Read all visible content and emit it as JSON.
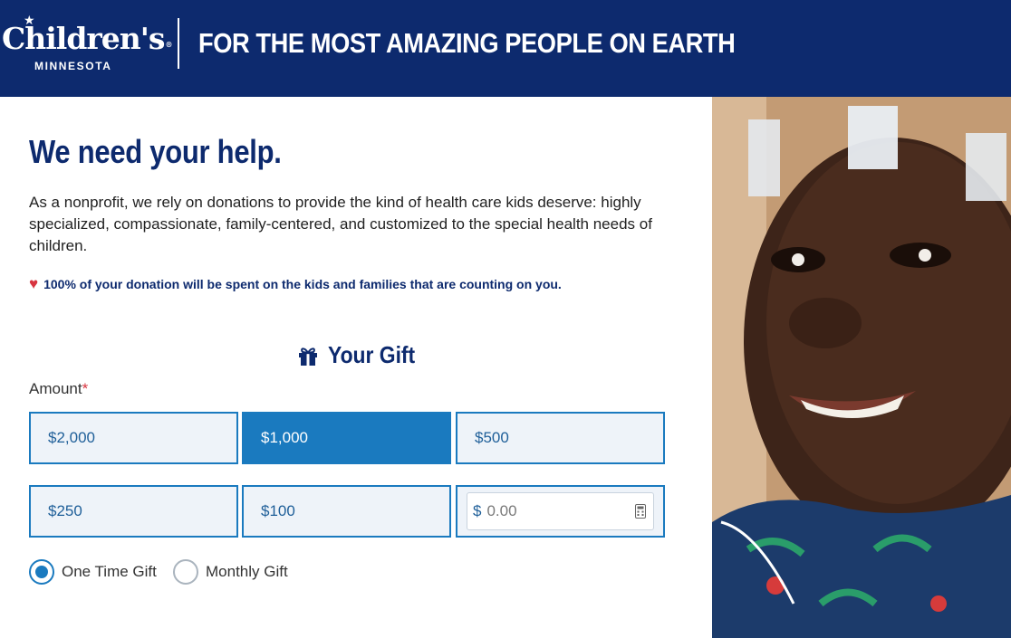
{
  "header": {
    "logo_main": "Children's",
    "logo_tm": "®",
    "logo_sub": "MINNESOTA",
    "tagline": "FOR THE MOST AMAZING PEOPLE ON EARTH",
    "background_color": "#0d2a6e"
  },
  "main": {
    "title": "We need your help.",
    "intro": "As a nonprofit, we rely on donations to provide the kind of health care kids deserve: highly specialized, compassionate, family-centered, and customized to the special health needs of children.",
    "pledge_icon": "heart-icon",
    "pledge": "100% of your donation will be spent on the kids and families that are counting on you."
  },
  "gift": {
    "icon": "gift-icon",
    "title": "Your Gift",
    "amount_label": "Amount",
    "required_marker": "*",
    "amounts": [
      "$2,000",
      "$1,000",
      "$500",
      "$250",
      "$100"
    ],
    "selected_amount": "$1,000",
    "custom_currency": "$",
    "custom_placeholder": "0.00",
    "custom_icon": "calculator-icon",
    "frequency_options": [
      "One Time Gift",
      "Monthly Gift"
    ],
    "selected_frequency": "One Time Gift",
    "accent_color": "#1a7abf"
  },
  "photo": {
    "alt": "Smiling child patient"
  }
}
